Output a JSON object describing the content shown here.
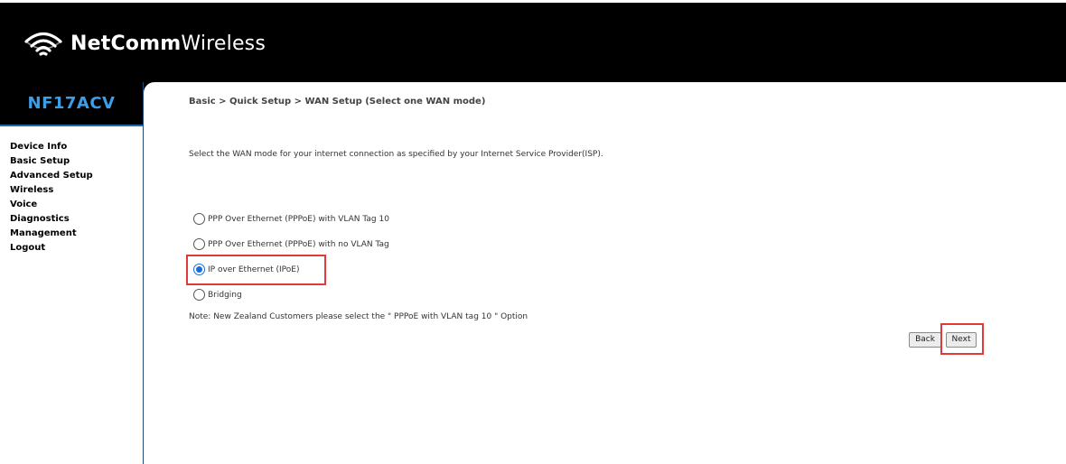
{
  "header": {
    "brand_bold": "NetComm",
    "brand_light": "Wireless",
    "logo_icon": "wifi-signal-icon"
  },
  "sidebar": {
    "model": "NF17ACV",
    "items": [
      {
        "label": "Device Info"
      },
      {
        "label": "Basic Setup"
      },
      {
        "label": "Advanced Setup"
      },
      {
        "label": "Wireless"
      },
      {
        "label": "Voice"
      },
      {
        "label": "Diagnostics"
      },
      {
        "label": "Management"
      },
      {
        "label": "Logout"
      }
    ]
  },
  "main": {
    "breadcrumb": "Basic > Quick Setup > WAN Setup (Select one WAN mode)",
    "intro": "Select the WAN mode for your internet connection as specified by your Internet Service Provider(ISP).",
    "options": [
      {
        "label": "PPP Over Ethernet (PPPoE) with VLAN Tag 10",
        "selected": false
      },
      {
        "label": "PPP Over Ethernet (PPPoE) with no VLAN Tag",
        "selected": false
      },
      {
        "label": "IP over Ethernet (IPoE)",
        "selected": true
      },
      {
        "label": "Bridging",
        "selected": false
      }
    ],
    "note": "Note: New Zealand Customers please select the \" PPPoE with VLAN tag 10 \" Option",
    "back_label": "Back",
    "next_label": "Next"
  },
  "colors": {
    "header_bg": "#000000",
    "model_text": "#3a9fe8",
    "radio_selected": "#1a6ed8",
    "highlight_box": "#e03a3a"
  }
}
